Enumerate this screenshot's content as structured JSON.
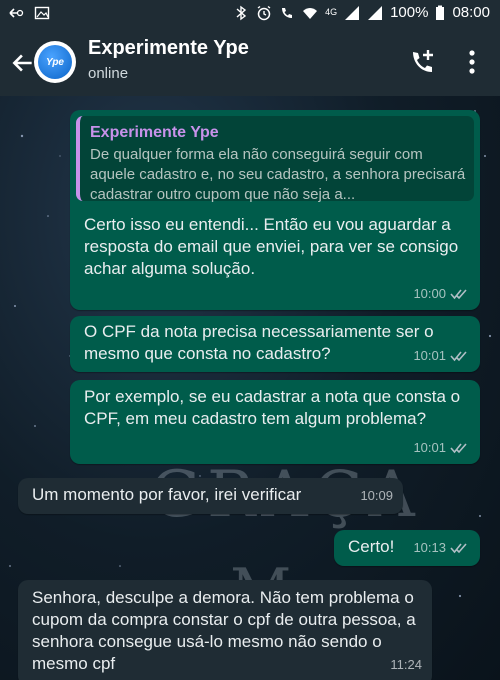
{
  "status_bar": {
    "battery": "100%",
    "time": "08:00",
    "network": "4G"
  },
  "header": {
    "contact_name": "Experimente Ype",
    "status": "online",
    "avatar_text": "Ype"
  },
  "background_text": {
    "line1": "GRAÇA",
    "line2": "M"
  },
  "messages": [
    {
      "quote_name": "Experimente Ype",
      "quote_text": "De qualquer forma ela não conseguirá seguir com aquele cadastro e, no seu cadastro, a senhora precisará cadastrar outro cupom que não seja a...",
      "text": "Certo isso eu entendi... Então eu vou aguardar a resposta do email que enviei, para ver se consigo achar alguma solução.",
      "time": "10:00",
      "direction": "out"
    },
    {
      "text": "O CPF da nota precisa necessariamente ser o mesmo que consta no cadastro?",
      "time": "10:01",
      "direction": "out"
    },
    {
      "text": "Por exemplo, se eu cadastrar a nota que consta o CPF, em meu cadastro tem algum problema?",
      "time": "10:01",
      "direction": "out"
    },
    {
      "text": "Um momento por favor, irei verificar",
      "time": "10:09",
      "direction": "in"
    },
    {
      "text": "Certo!",
      "time": "10:13",
      "direction": "out"
    },
    {
      "text": "Senhora, desculpe a demora. Não tem problema o cupom da compra constar o cpf de outra pessoa, a senhora consegue usá-lo mesmo não sendo o mesmo cpf",
      "time": "11:24",
      "direction": "in"
    }
  ],
  "colors": {
    "outgoing_bubble": "#005c4b",
    "incoming_bubble": "#1f2c34",
    "quote_accent": "#c792ea",
    "app_bar": "#1f2c34"
  }
}
